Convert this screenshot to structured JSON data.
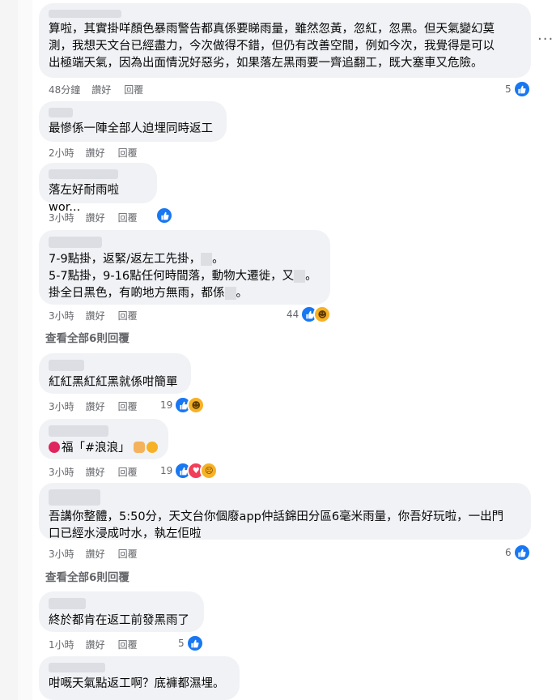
{
  "comments": [
    {
      "author": "",
      "text": "算啦，其實掛咩顏色暴雨警告都真係要睇雨量，雖然忽黃，忽紅，忽黑。但天氣變幻莫\n測，我想天文台已經盡力，今次做得不錯，但仍有改善空間，例如今次，我覺得是可以\n出極端天氣，因為出面情況好惡劣，如果落左黑雨要一齊追翻工，既大塞車又危險。",
      "time": "48分鐘",
      "like": "讚好",
      "reply": "回覆",
      "reactions": "5"
    },
    {
      "author": "",
      "text": "最慘係一陣全部人迫埋同時返工",
      "time": "2小時",
      "like": "讚好",
      "reply": "回覆",
      "reactions": ""
    },
    {
      "author": "",
      "text": "落左好耐雨啦wor...",
      "time": "3小時",
      "like": "讚好",
      "reply": "回覆",
      "reactions": ""
    },
    {
      "author": "",
      "line1": "7-9點掛，返緊/返左工先掛，",
      "line2": "5-7點掛，9-16點任何時間落，動物大遷徙，又",
      "line3": "掛全日黑色，有啲地方無雨，都係",
      "time": "3小時",
      "like": "讚好",
      "reply": "回覆",
      "reactions": "44"
    },
    {
      "author": "",
      "text": "紅紅黑紅紅黑就係咁簡單",
      "time": "3小時",
      "like": "讚好",
      "reply": "回覆",
      "reactions": "19"
    },
    {
      "author": "",
      "text": "福「#浪浪」",
      "time": "3小時",
      "like": "讚好",
      "reply": "回覆",
      "reactions": "19"
    },
    {
      "author": "",
      "text": "吾講你整體，5:50分，天文台你個廢app仲話錦田分區6毫米雨量，你吾好玩啦，一出門\n口已經水浸成吋水，執左佢啦",
      "time": "3小時",
      "like": "讚好",
      "reply": "回覆",
      "reactions": "6"
    },
    {
      "author": "",
      "text": "終於都肯在返工前發黑雨了",
      "time": "1小時",
      "like": "讚好",
      "reply": "回覆",
      "reactions": "5"
    },
    {
      "author": "",
      "text": "咁嘅天氣點返工啊？底褲都濕埋。",
      "time": "",
      "like": "",
      "reply": "",
      "reactions": ""
    }
  ],
  "view_all_replies_1": "查看全部6則回覆",
  "view_all_replies_2": "查看全部6則回覆",
  "more_options": "···",
  "colors": {
    "like_blue": "#1877f2",
    "bubble_bg": "#f0f2f5",
    "meta_gray": "#65676b"
  }
}
